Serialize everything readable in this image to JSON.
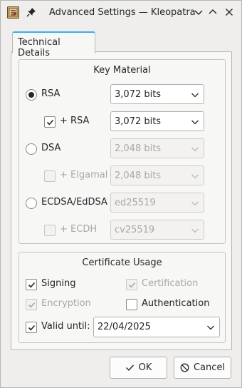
{
  "window": {
    "title": "Advanced Settings — Kleopatra"
  },
  "tab": {
    "label": "Technical Details"
  },
  "key_material": {
    "title": "Key Material",
    "rsa": {
      "label": "RSA",
      "selected": true,
      "value": "3,072 bits"
    },
    "rsa_sub": {
      "label": "+ RSA",
      "checked": true,
      "value": "3,072 bits"
    },
    "dsa": {
      "label": "DSA",
      "selected": false,
      "value": "2,048 bits"
    },
    "elgamal": {
      "label": "+ Elgamal",
      "checked": false,
      "value": "2,048 bits"
    },
    "ecdsa": {
      "label": "ECDSA/EdDSA",
      "selected": false,
      "value": "ed25519"
    },
    "ecdh": {
      "label": "+ ECDH",
      "checked": false,
      "value": "cv25519"
    }
  },
  "certificate_usage": {
    "title": "Certificate Usage",
    "signing": {
      "label": "Signing",
      "checked": true
    },
    "certification": {
      "label": "Certification",
      "checked": true,
      "disabled": true
    },
    "encryption": {
      "label": "Encryption",
      "checked": true,
      "disabled": true
    },
    "authentication": {
      "label": "Authentication",
      "checked": false
    },
    "valid_until": {
      "label": "Valid until:",
      "checked": true,
      "value": "22/04/2025"
    }
  },
  "buttons": {
    "ok": "OK",
    "cancel": "Cancel"
  },
  "colors": {
    "accent": "#3daee9",
    "background": "#efeeed"
  },
  "icons": [
    "kleopatra-app-icon",
    "pin-icon",
    "chevron-down-icon",
    "chevron-up-icon",
    "close-icon",
    "check-icon",
    "cancel-icon"
  ]
}
